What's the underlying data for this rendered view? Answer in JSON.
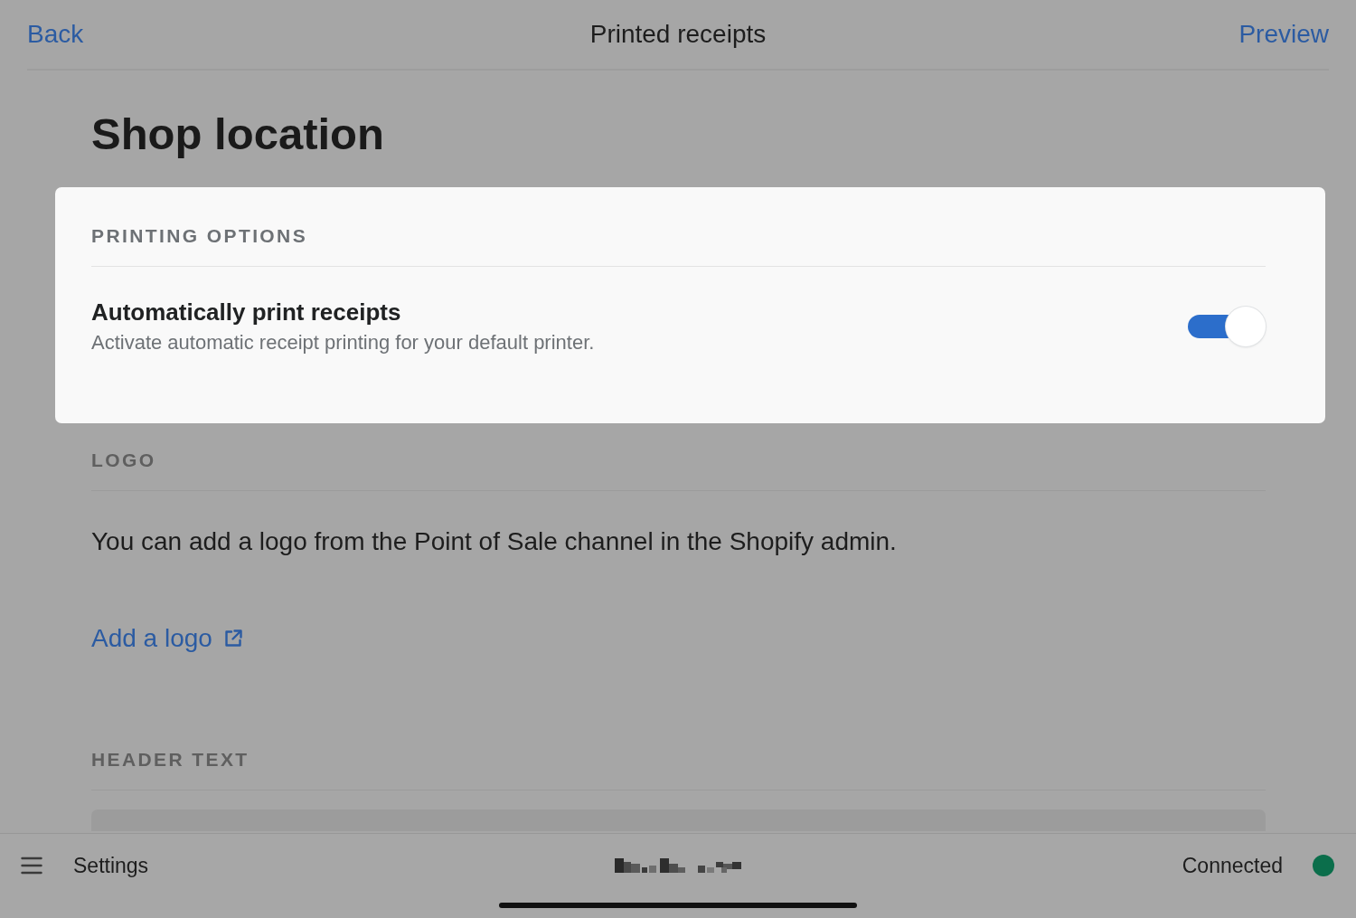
{
  "nav_bar": {
    "back": "Back",
    "title": "Printed receipts",
    "preview": "Preview"
  },
  "page_title": "Shop location",
  "sections": [
    {
      "kind": "card",
      "heading": "PRINTING OPTIONS",
      "settings": [
        {
          "label": "Automatically print receipts",
          "description": "Activate automatic receipt printing for your default printer.",
          "on": true
        }
      ]
    },
    {
      "kind": "info",
      "heading": "LOGO",
      "text": "You can add a logo from the Point of Sale channel in the Shopify admin.",
      "link": "Add a logo"
    },
    {
      "kind": "field",
      "heading": "HEADER TEXT"
    }
  ],
  "bottom_bar": {
    "menu_label": "Settings",
    "status": "Connected",
    "connected": true
  }
}
